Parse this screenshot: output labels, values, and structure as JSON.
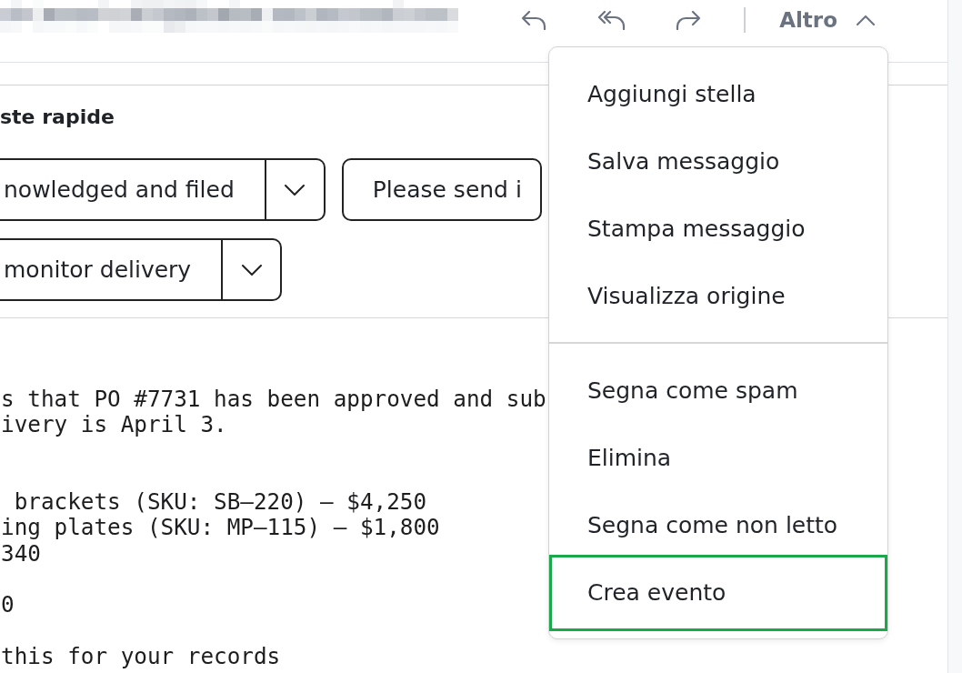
{
  "toolbar": {
    "more": {
      "label": "Altro",
      "expanded": true,
      "menu_groups": [
        {
          "items": [
            {
              "label": "Aggiungi stella",
              "selected": false
            },
            {
              "label": "Salva messaggio",
              "selected": false
            },
            {
              "label": "Stampa messaggio",
              "selected": false
            },
            {
              "label": "Visualizza origine",
              "selected": false
            }
          ]
        },
        {
          "items": [
            {
              "label": "Segna come spam",
              "selected": false
            },
            {
              "label": "Elimina",
              "selected": false
            },
            {
              "label": "Segna come non letto",
              "selected": false
            },
            {
              "label": "Crea evento",
              "selected": true
            }
          ]
        }
      ]
    }
  },
  "quick_replies": {
    "title": "ste rapide",
    "rows": [
      [
        {
          "label": "nowledged and filed",
          "kind": "split"
        },
        {
          "label": "Please send i",
          "kind": "plain"
        }
      ],
      [
        {
          "label": "monitor delivery",
          "kind": "split"
        }
      ]
    ]
  },
  "message": {
    "body": "s that PO #7731 has been approved and sub\nivery is April 3.\n\n\n brackets (SKU: SB–220) – $4,250\ning plates (SKU: MP–115) – $1,800\n340\n\n0\n\nthis for your records"
  }
}
